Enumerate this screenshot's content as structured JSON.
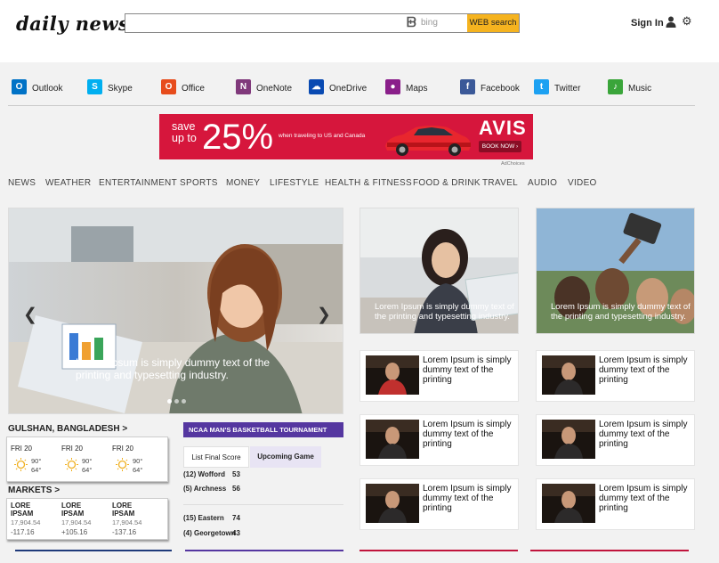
{
  "header": {
    "logo": "daily news",
    "search_placeholder": "",
    "bing_label": "bing",
    "search_button": "WEB search",
    "sign_in": "Sign In"
  },
  "apps": [
    {
      "label": "Outlook",
      "icon": "outlook-icon",
      "color": "#0072c6",
      "glyph": "O"
    },
    {
      "label": "Skype",
      "icon": "skype-icon",
      "color": "#00aff0",
      "glyph": "S"
    },
    {
      "label": "Office",
      "icon": "office-icon",
      "color": "#e74c1c",
      "glyph": "O"
    },
    {
      "label": "OneNote",
      "icon": "onenote-icon",
      "color": "#80397b",
      "glyph": "N"
    },
    {
      "label": "OneDrive",
      "icon": "onedrive-icon",
      "color": "#094ab2",
      "glyph": "☁"
    },
    {
      "label": "Maps",
      "icon": "maps-pin-icon",
      "color": "#8a1f8a",
      "glyph": "●"
    },
    {
      "label": "Facebook",
      "icon": "facebook-icon",
      "color": "#3b5998",
      "glyph": "f"
    },
    {
      "label": "Twitter",
      "icon": "twitter-icon",
      "color": "#1da1f2",
      "glyph": "t"
    },
    {
      "label": "Music",
      "icon": "music-icon",
      "color": "#3aa53a",
      "glyph": "♪"
    }
  ],
  "ad": {
    "save": "save",
    "up_to": "up to",
    "percent": "25%",
    "sub": "when traveling to US and Canada",
    "brand": "AVIS",
    "cta": "BOOK NOW ›",
    "choices": "AdChoices"
  },
  "nav": [
    "NEWS",
    "WEATHER",
    "ENTERTAINMENT",
    "SPORTS",
    "MONEY",
    "LIFESTYLE",
    "HEALTH & FITNESS",
    "FOOD & DRINK",
    "TRAVEL",
    "AUDIO",
    "VIDEO"
  ],
  "hero": {
    "caption": "Lorem Ipsum is simply dummy text of the printing and typesetting industry.",
    "prev": "❮",
    "next": "❯"
  },
  "tiles": [
    {
      "caption": "Lorem Ipsum is simply dummy text of the printing and typesetting industry."
    },
    {
      "caption": "Lorem Ipsum is simply dummy text of the printing and typesetting industry."
    }
  ],
  "news_rows": [
    "Lorem Ipsum is simply dummy text of the printing",
    "Lorem Ipsum is simply dummy text of the printing",
    "Lorem Ipsum is simply dummy text of the printing",
    "Lorem Ipsum is simply dummy text of the printing",
    "Lorem Ipsum is simply dummy text of the printing",
    "Lorem Ipsum is simply dummy text of the printing"
  ],
  "weather": {
    "location": "GULSHAN, BANGLADESH >",
    "days": [
      {
        "day": "FRI 20",
        "hi": "90°",
        "lo": "64°",
        "icon": "sun-icon"
      },
      {
        "day": "FRI 20",
        "hi": "90°",
        "lo": "64°",
        "icon": "sun-icon"
      },
      {
        "day": "FRI 20",
        "hi": "90°",
        "lo": "64°",
        "icon": "sun-icon"
      }
    ]
  },
  "markets": {
    "title": "MARKETS >",
    "items": [
      {
        "name_line1": "LORE",
        "name_line2": "IPSAM",
        "value": "17,904.54",
        "change": "-117.16"
      },
      {
        "name_line1": "LORE",
        "name_line2": "IPSAM",
        "value": "17,904.54",
        "change": "+105.16"
      },
      {
        "name_line1": "LORE",
        "name_line2": "IPSAM",
        "value": "17,904.54",
        "change": "-137.16"
      }
    ]
  },
  "ncaa": {
    "title": "NCAA MAN'S BASKETBALL TOURNAMENT",
    "tab_final": "List Final Score",
    "tab_upcoming": "Upcoming Game",
    "games": [
      [
        {
          "team": "(12) Wofford",
          "score": "53"
        },
        {
          "team": "(5) Archness",
          "score": "56"
        }
      ],
      [
        {
          "team": "(15) Eastern",
          "score": "74"
        },
        {
          "team": "(4) Georgetown",
          "score": "43"
        }
      ]
    ]
  },
  "colors": {
    "search_button": "#f5b31f",
    "ad_red": "#d6163c",
    "ncaa_purple": "#5537a0",
    "rule_navy": "#1f3a7a",
    "rule_purple": "#5537a0",
    "rule_crimson": "#c0143c"
  }
}
